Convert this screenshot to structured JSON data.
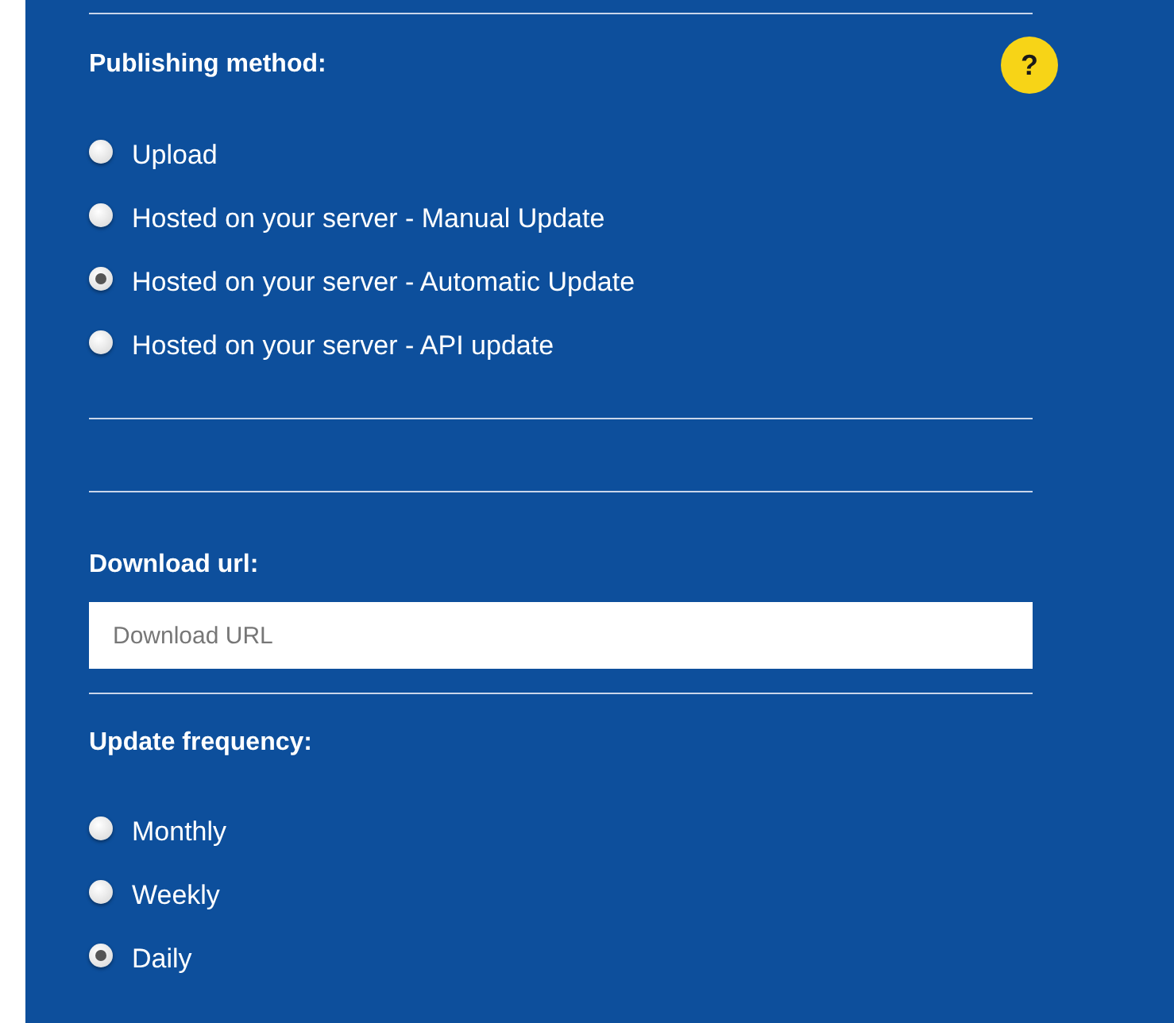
{
  "publishing_method": {
    "label": "Publishing method:",
    "help": "?",
    "options": [
      {
        "label": "Upload",
        "selected": false
      },
      {
        "label": "Hosted on your server - Manual Update",
        "selected": false
      },
      {
        "label": "Hosted on your server - Automatic Update",
        "selected": true
      },
      {
        "label": "Hosted on your server - API update",
        "selected": false
      }
    ]
  },
  "download_url": {
    "label": "Download url:",
    "placeholder": "Download URL"
  },
  "update_frequency": {
    "label": "Update frequency:",
    "options": [
      {
        "label": "Monthly",
        "selected": false
      },
      {
        "label": "Weekly",
        "selected": false
      },
      {
        "label": "Daily",
        "selected": true
      }
    ]
  }
}
